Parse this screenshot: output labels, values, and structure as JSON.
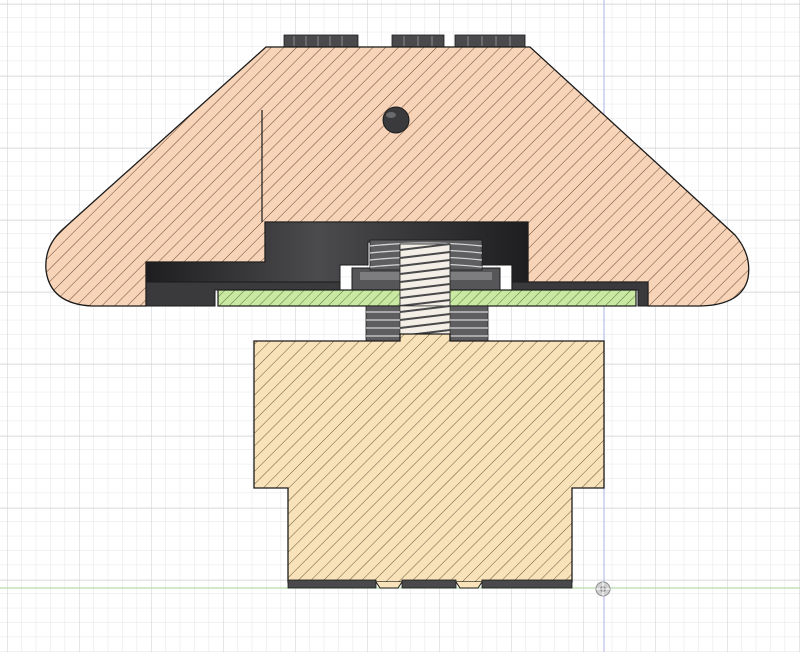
{
  "viewport": {
    "background": "#ffffff",
    "grid_minor_color": "#e4e6ea",
    "grid_major_color": "#c9ccd2",
    "axis_x_color": "#b6dcaa",
    "axis_y_color": "#b9bfe6"
  },
  "section_view": {
    "cap": {
      "fill": "#f7d4b7",
      "hatch": "#5a3a2a",
      "outline": "#1b1b1b"
    },
    "base": {
      "fill": "#f8e2b9",
      "hatch": "#5a4a30",
      "outline": "#1b1b1b"
    },
    "plate": {
      "fill": "#c9e8a2",
      "hatch": "#3c5a28",
      "outline": "#1b1b1b"
    },
    "cavity": {
      "fill": "#2e2e30"
    },
    "thread": {
      "fill": "#6b6b6b",
      "highlight": "#d9d9d9"
    }
  },
  "origin_icon": "origin-point-icon"
}
